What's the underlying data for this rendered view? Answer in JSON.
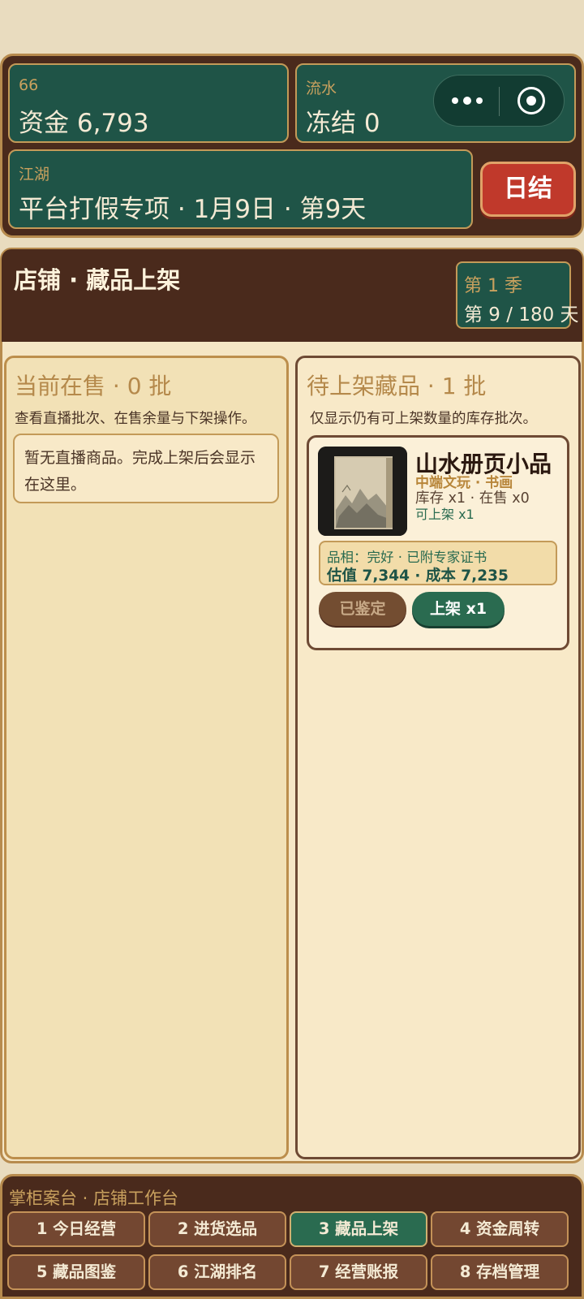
{
  "status": {
    "funds": {
      "label": "66",
      "value": "资金 6,793"
    },
    "flow": {
      "label": "流水",
      "value": "冻结 0"
    },
    "jianghu": {
      "label": "江湖",
      "value": "平台打假专项 · 1月9日 · 第9天"
    },
    "settle_label": "日结"
  },
  "shop": {
    "title": "店铺 · 藏品上架",
    "season": "第 1 季",
    "day": "第 9 / 180 天"
  },
  "on_sale": {
    "title": "当前在售 · 0 批",
    "desc": "查看直播批次、在售余量与下架操作。",
    "empty_text": "暂无直播商品。完成上架后会显示在这里。"
  },
  "pending": {
    "title": "待上架藏品 · 1 批",
    "desc": "仅显示仍有可上架数量的库存批次。",
    "items": [
      {
        "name": "山水册页小品",
        "category": "中端文玩 · 书画",
        "stock": "库存 x1 · 在售 x0",
        "listable": "可上架 x1",
        "condition": "品相：完好 · 已附专家证书",
        "value": "估值 7,344 · 成本 7,235",
        "appraised_label": "已鉴定",
        "list_label": "上架 x1"
      }
    ]
  },
  "nav": {
    "title": "掌柜案台 · 店铺工作台",
    "items": [
      {
        "label": "1 今日经营",
        "active": false
      },
      {
        "label": "2 进货选品",
        "active": false
      },
      {
        "label": "3 藏品上架",
        "active": true
      },
      {
        "label": "4 资金周转",
        "active": false
      },
      {
        "label": "5 藏品图鉴",
        "active": false
      },
      {
        "label": "6 江湖排名",
        "active": false
      },
      {
        "label": "7 经营账报",
        "active": false
      },
      {
        "label": "8 存档管理",
        "active": false
      }
    ]
  }
}
